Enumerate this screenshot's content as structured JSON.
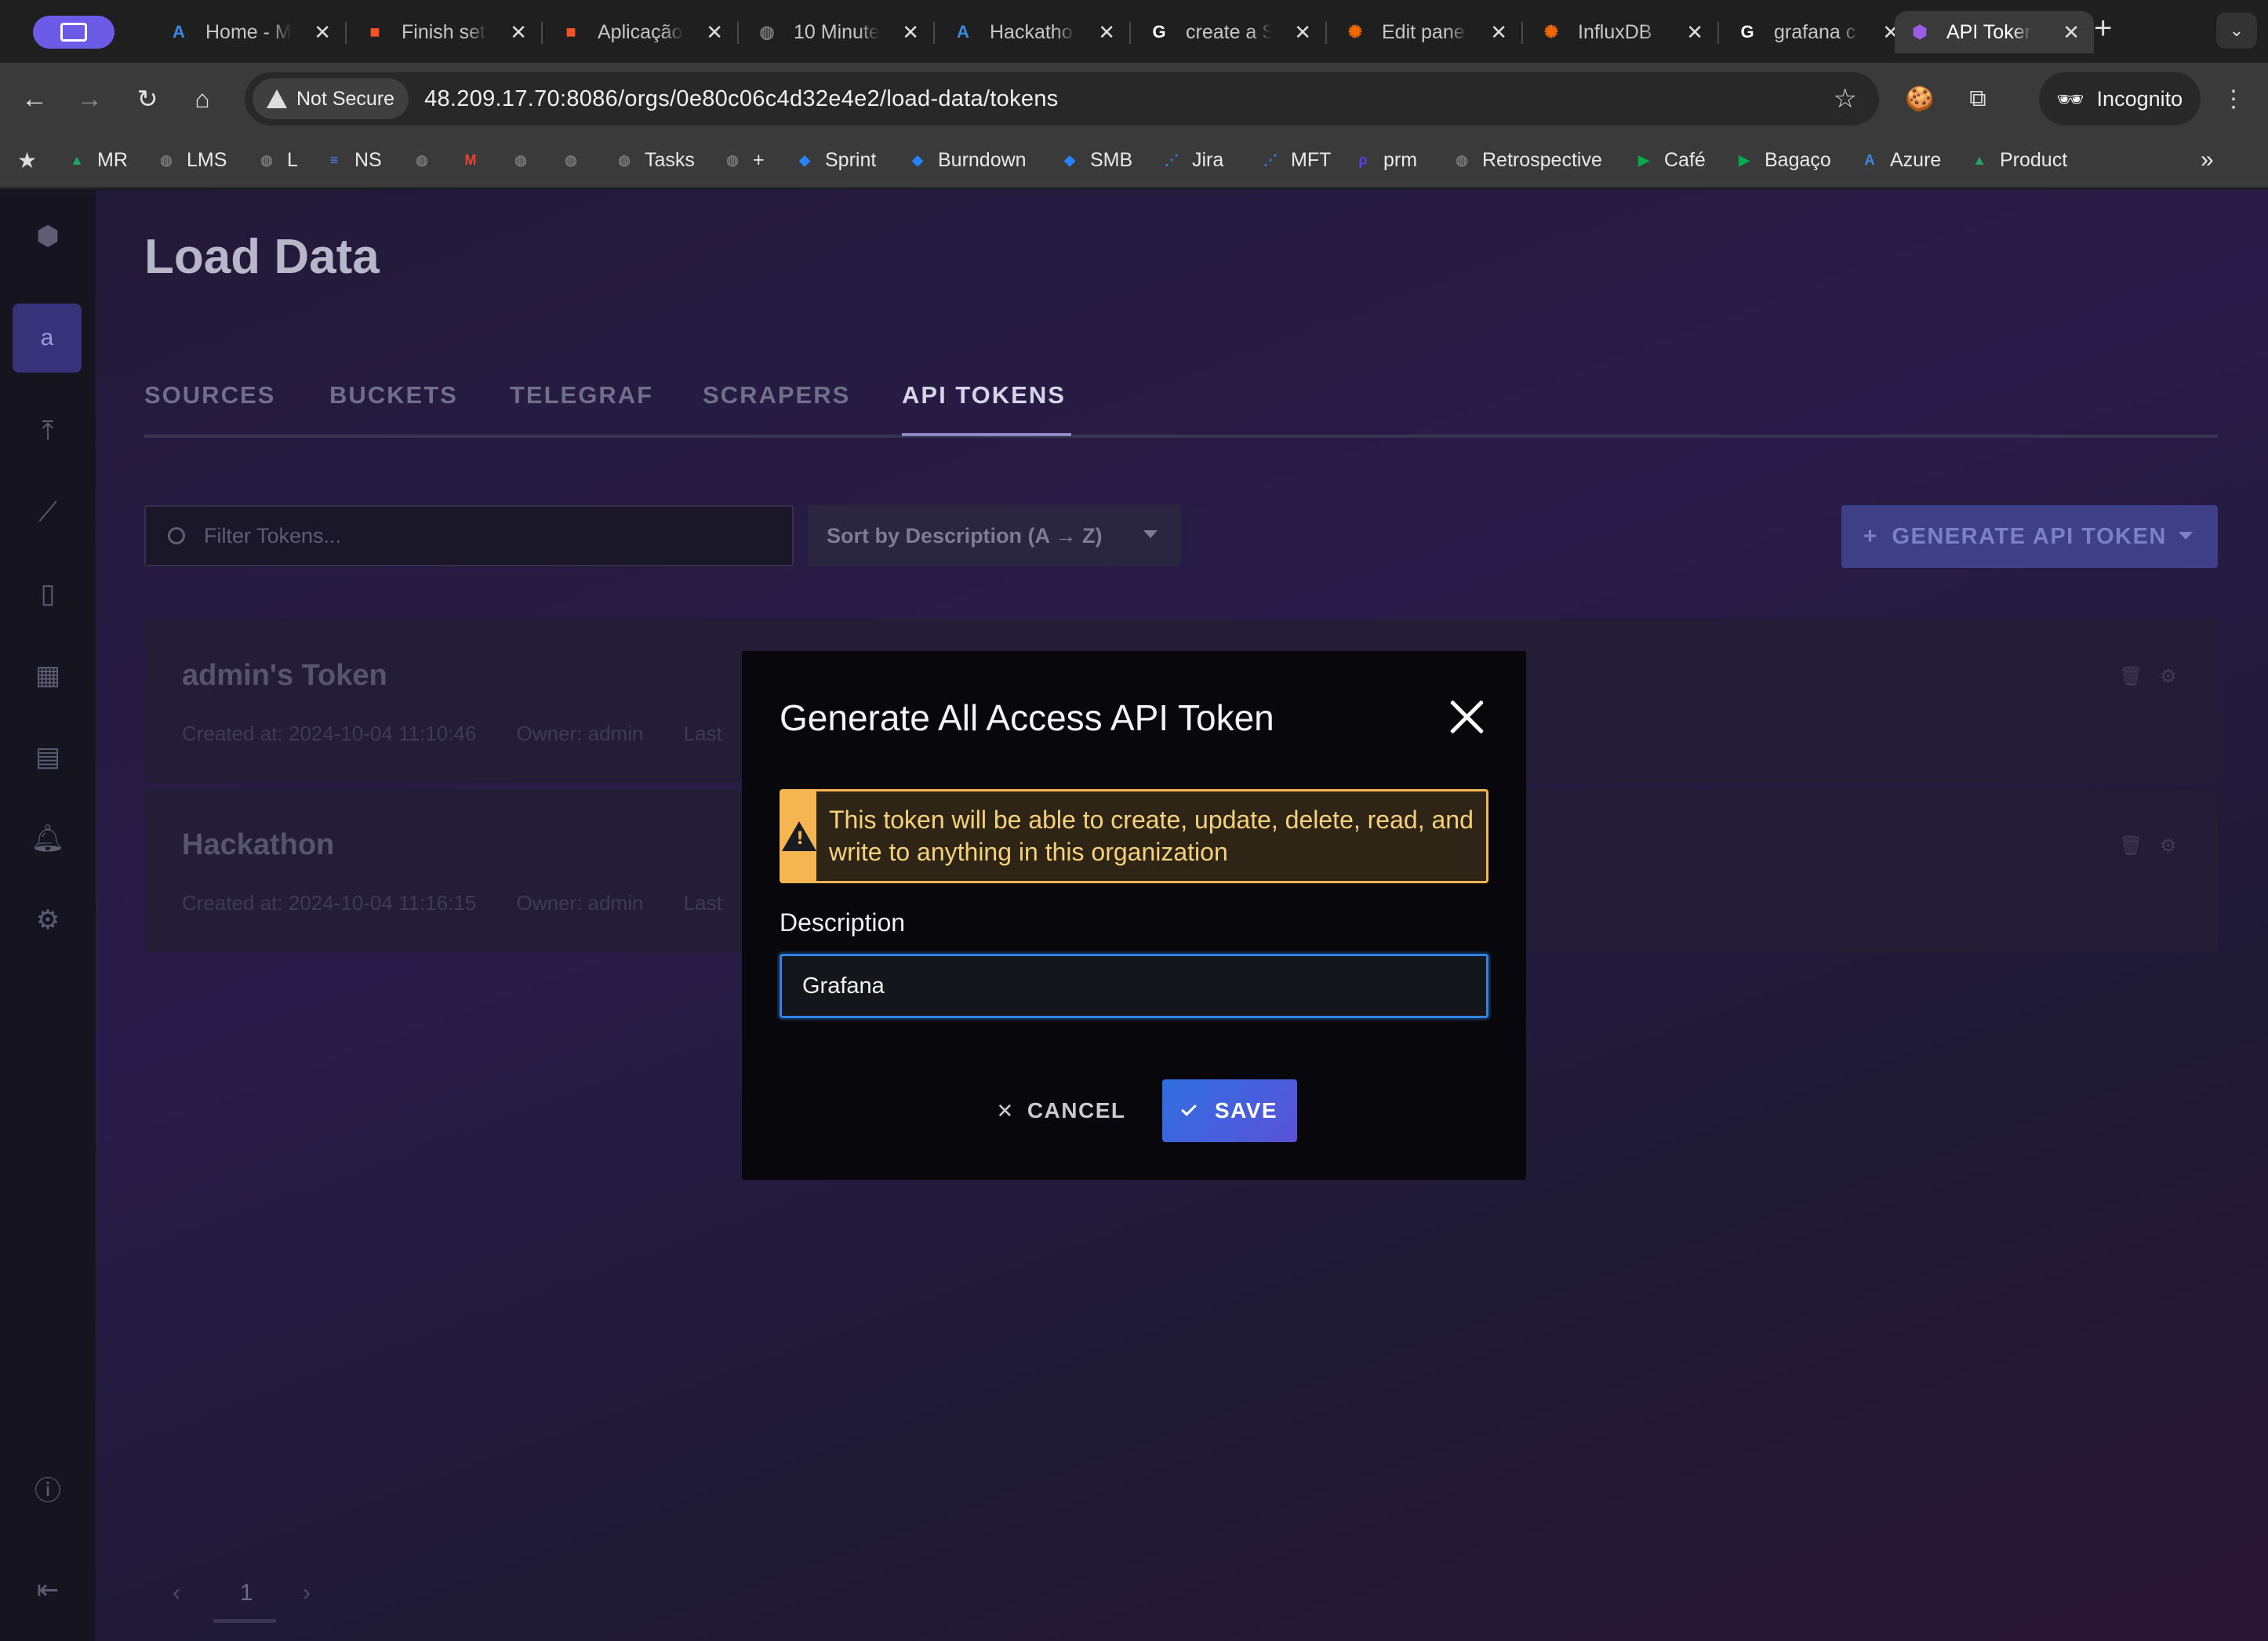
{
  "browser": {
    "tabs": [
      {
        "title": "Home - M",
        "icon": "azure-icon",
        "color": "#3b8be6"
      },
      {
        "title": "Finish set",
        "icon": "microsoft-icon",
        "color": "#f35325"
      },
      {
        "title": "Aplicação",
        "icon": "microsoft-icon",
        "color": "#f35325"
      },
      {
        "title": "10 Minute",
        "icon": "globe-icon",
        "color": "#777777"
      },
      {
        "title": "Hackatho",
        "icon": "azure-icon",
        "color": "#3b8be6"
      },
      {
        "title": "create a S",
        "icon": "google-icon",
        "color": "#ffffff"
      },
      {
        "title": "Edit pane",
        "icon": "grafana-icon",
        "color": "#f46800"
      },
      {
        "title": "InfluxDB",
        "icon": "grafana-icon",
        "color": "#f46800"
      },
      {
        "title": "grafana c",
        "icon": "google-icon",
        "color": "#ffffff"
      },
      {
        "title": "API Token",
        "icon": "influx-icon",
        "color": "#9b5de5",
        "active": true
      }
    ],
    "security_label": "Not Secure",
    "url": "48.209.17.70:8086/orgs/0e80c06c4d32e4e2/load-data/tokens",
    "incognito_label": "Incognito",
    "bookmarks": [
      {
        "label": "MR",
        "icon": "drive-icon",
        "color": "#1fa463"
      },
      {
        "label": "LMS",
        "icon": "globe-icon",
        "color": "#777777"
      },
      {
        "label": "L",
        "icon": "globe-icon",
        "color": "#777777"
      },
      {
        "label": "NS",
        "icon": "docs-icon",
        "color": "#4285f4"
      },
      {
        "label": "",
        "icon": "globe-icon",
        "color": "#777777"
      },
      {
        "label": "",
        "icon": "gmail-icon",
        "color": "#ea4335"
      },
      {
        "label": "",
        "icon": "globe-icon",
        "color": "#777777"
      },
      {
        "label": "",
        "icon": "globe-icon",
        "color": "#777777"
      },
      {
        "label": "Tasks",
        "icon": "globe-icon",
        "color": "#777777"
      },
      {
        "label": "+",
        "icon": "globe-icon",
        "color": "#777777"
      },
      {
        "label": "Sprint",
        "icon": "jira-diamond-icon",
        "color": "#2684ff"
      },
      {
        "label": "Burndown",
        "icon": "jira-diamond-icon",
        "color": "#2684ff"
      },
      {
        "label": "SMB",
        "icon": "jira-diamond-icon",
        "color": "#2684ff"
      },
      {
        "label": "Jira",
        "icon": "jira-icon",
        "color": "#2684ff"
      },
      {
        "label": "MFT",
        "icon": "jira-icon",
        "color": "#2684ff"
      },
      {
        "label": "prm",
        "icon": "prm-icon",
        "color": "#5b3cf0"
      },
      {
        "label": "Retrospective",
        "icon": "globe-icon",
        "color": "#777777"
      },
      {
        "label": "Café",
        "icon": "meet-icon",
        "color": "#00ac47"
      },
      {
        "label": "Bagaço",
        "icon": "meet-icon",
        "color": "#00ac47"
      },
      {
        "label": "Azure",
        "icon": "azure-icon",
        "color": "#3b8be6"
      },
      {
        "label": "Product",
        "icon": "drive-icon",
        "color": "#1fa463"
      }
    ]
  },
  "app": {
    "page_title": "Load Data",
    "tabs": [
      "SOURCES",
      "BUCKETS",
      "TELEGRAF",
      "SCRAPERS",
      "API TOKENS"
    ],
    "active_tab": "API TOKENS",
    "filter_placeholder": "Filter Tokens...",
    "sort_label": "Sort by Description (A → Z)",
    "generate_label": "GENERATE API TOKEN",
    "tokens": [
      {
        "name": "admin's Token",
        "created": "Created at: 2024-10-04 11:10:46",
        "owner": "Owner: admin",
        "last": "Last"
      },
      {
        "name": "Hackathon",
        "created": "Created at: 2024-10-04 11:16:15",
        "owner": "Owner: admin",
        "last": "Last"
      }
    ],
    "page_number": "1"
  },
  "modal": {
    "title": "Generate All Access API Token",
    "warning": "This token will be able to create, update, delete, read, and write to anything in this organization",
    "description_label": "Description",
    "description_value": "Grafana",
    "cancel_label": "CANCEL",
    "save_label": "SAVE"
  }
}
